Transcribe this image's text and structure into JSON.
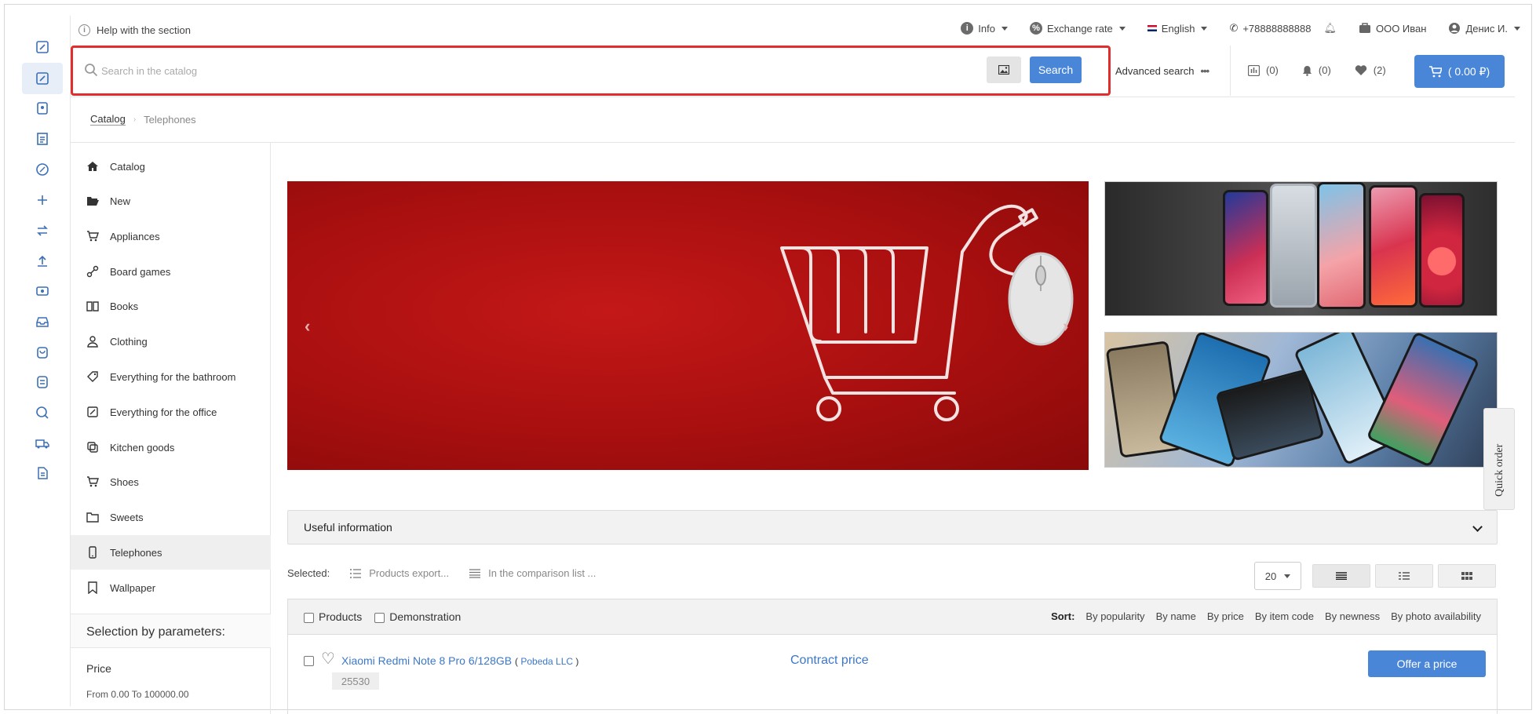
{
  "topbar": {
    "help": "Help with the section",
    "info": "Info",
    "exchange": "Exchange rate",
    "language": "English",
    "phone": "+78888888888",
    "company": "ООО Иван",
    "user": "Денис И."
  },
  "search": {
    "placeholder": "Search in the catalog",
    "button": "Search",
    "advanced": "Advanced search"
  },
  "counters": {
    "compare": "(0)",
    "notifications": "(0)",
    "favorites": "(2)",
    "cart": "( 0.00 ₽)"
  },
  "breadcrumb": {
    "root": "Catalog",
    "current": "Telephones"
  },
  "categories": [
    {
      "label": "Catalog",
      "icon": "home-icon"
    },
    {
      "label": "New",
      "icon": "folder-open-icon"
    },
    {
      "label": "Appliances",
      "icon": "cart-icon"
    },
    {
      "label": "Board games",
      "icon": "game-icon"
    },
    {
      "label": "Books",
      "icon": "book-icon"
    },
    {
      "label": "Clothing",
      "icon": "user-icon"
    },
    {
      "label": "Everything for the bathroom",
      "icon": "tag-icon"
    },
    {
      "label": "Everything for the office",
      "icon": "office-icon"
    },
    {
      "label": "Kitchen goods",
      "icon": "copy-icon"
    },
    {
      "label": "Shoes",
      "icon": "cart-icon"
    },
    {
      "label": "Sweets",
      "icon": "folder-icon"
    },
    {
      "label": "Telephones",
      "icon": "phone-icon"
    },
    {
      "label": "Wallpaper",
      "icon": "bookmark-icon"
    }
  ],
  "filters": {
    "title": "Selection by parameters:",
    "price": "Price",
    "price_range": "From 0.00 To 100000.00"
  },
  "useful": "Useful information",
  "quick_order": "Quick order",
  "toolbar": {
    "selected": "Selected:",
    "export": "Products export...",
    "compare": "In the comparison list ...",
    "per_page": "20"
  },
  "table": {
    "col_products": "Products",
    "col_demo": "Demonstration",
    "sort_label": "Sort:",
    "sort_options": [
      "By popularity",
      "By name",
      "By price",
      "By item code",
      "By newness",
      "By photo availability"
    ]
  },
  "product": {
    "name": "Xiaomi Redmi Note 8 Pro 6/128GB",
    "vendor": "Pobeda LLC",
    "code": "25530",
    "price": "Contract price",
    "offer": "Offer a price"
  },
  "colors": {
    "accent": "#4a86d8",
    "highlight": "#e02d2d",
    "banner": "#b01212"
  }
}
